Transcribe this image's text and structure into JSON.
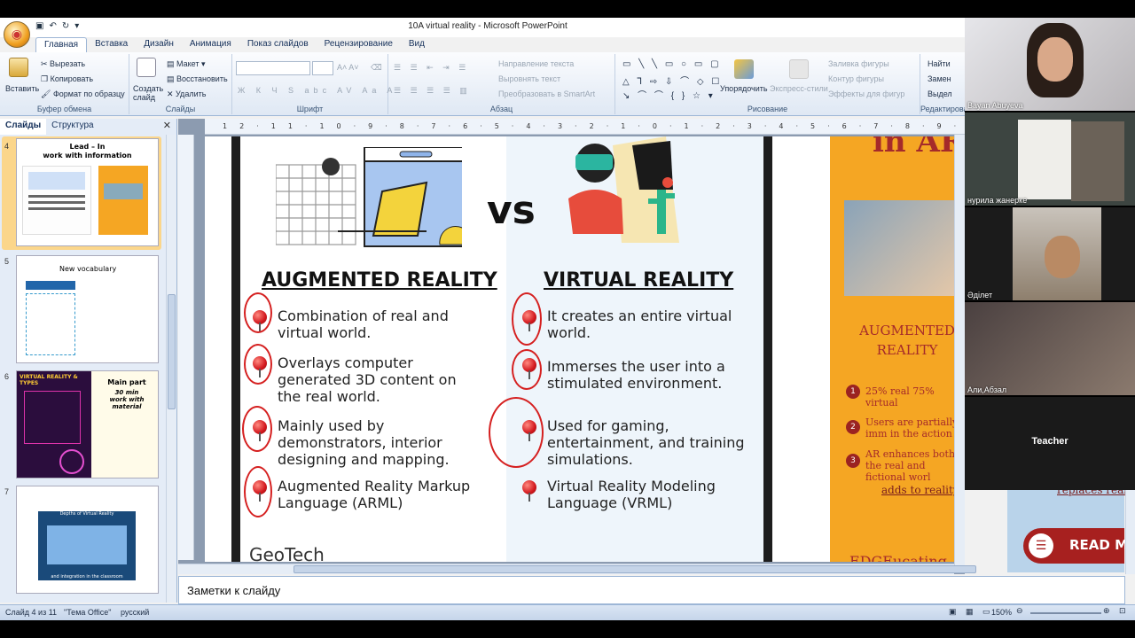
{
  "window": {
    "title": "10A virtual reality - Microsoft PowerPoint"
  },
  "ribbon_tabs": [
    "Главная",
    "Вставка",
    "Дизайн",
    "Анимация",
    "Показ слайдов",
    "Рецензирование",
    "Вид"
  ],
  "ribbon": {
    "clipboard": {
      "label": "Буфер обмена",
      "paste": "Вставить",
      "cut": "Вырезать",
      "copy": "Копировать",
      "format_painter": "Формат по образцу"
    },
    "slides": {
      "label": "Слайды",
      "new_slide": "Создать слайд",
      "layout": "Макет",
      "reset": "Восстановить",
      "delete": "Удалить"
    },
    "font": {
      "label": "Шрифт"
    },
    "paragraph": {
      "label": "Абзац",
      "text_direction": "Направление текста",
      "align_text": "Выровнять текст",
      "smartart": "Преобразовать в SmartArt"
    },
    "drawing": {
      "label": "Рисование",
      "arrange": "Упорядочить",
      "quick_styles": "Экспресс-стили",
      "shape_fill": "Заливка фигуры",
      "shape_outline": "Контур фигуры",
      "shape_effects": "Эффекты для фигур"
    },
    "editing": {
      "label": "Редактирова",
      "find": "Найти",
      "replace": "Замен",
      "select": "Выдел"
    }
  },
  "panel": {
    "tabs": [
      "Слайды",
      "Структура"
    ],
    "thumbnails": [
      {
        "num": "4",
        "title": "Lead – In",
        "subtitle": "work with information"
      },
      {
        "num": "5",
        "title": "New vocabulary"
      },
      {
        "num": "6",
        "title": "Main part",
        "subtitle": "30 min work with material",
        "left_title": "VIRTUAL REALITY & TYPES"
      },
      {
        "num": "7",
        "title": "Depths of Virtual Reality",
        "subtitle": "and integration in the classroom"
      }
    ]
  },
  "slide": {
    "vs": "vs",
    "ar_heading": "AUGMENTED REALITY",
    "vr_heading": "VIRTUAL REALITY",
    "ar_points": [
      "Combination of real and virtual world.",
      "Overlays computer generated 3D content on the real world.",
      "Mainly used by demonstrators, interior designing and mapping.",
      "Augmented Reality Markup Language (ARML)"
    ],
    "vr_points": [
      "It creates an entire virtual world.",
      "Immerses the user into a stimulated environment.",
      "Used for gaming, entertainment, and training simulations.",
      "Virtual Reality Modeling Language (VRML)"
    ],
    "footer_brand": "GeoTech",
    "right_panel": {
      "top_title": "in AR",
      "heading": "AUGMENTED REALITY",
      "items": [
        {
          "n": "1",
          "text": "25% real 75% virtual"
        },
        {
          "n": "2",
          "text": "Users are partially imm in the action"
        },
        {
          "n": "3",
          "text": "AR enhances both the real and fictional worl"
        }
      ],
      "link": "adds to reality",
      "link2": "replaces real",
      "read_more": "READ M",
      "edge": "EDGEucating"
    }
  },
  "notes": {
    "placeholder": "Заметки к слайду"
  },
  "status": {
    "slide": "Слайд 4 из 11",
    "theme": "\"Тема Office\"",
    "lang": "русский",
    "zoom": "150%"
  },
  "video": {
    "participants": [
      "Bayan Abuyeva",
      "нурила жанерке",
      "Әділет",
      "Али,Абзал",
      "Teacher"
    ]
  },
  "colors": {
    "ribbon_blue": "#dfe8f4",
    "accent_red": "#d3181e",
    "orange_panel": "#f5a623"
  }
}
